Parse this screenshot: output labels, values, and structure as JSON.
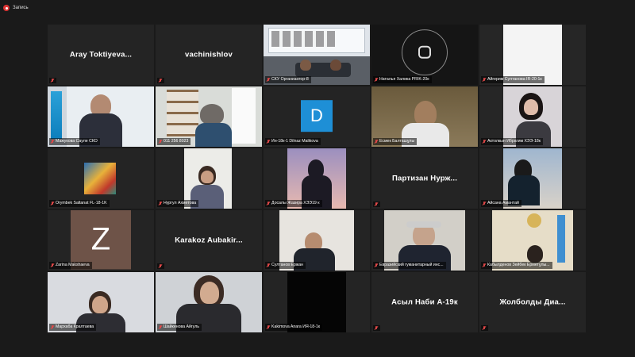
{
  "recording": {
    "label": "Запись"
  },
  "tiles": [
    {
      "kind": "name",
      "center": "Aray  Toktiyeva...",
      "plate": ""
    },
    {
      "kind": "name",
      "center": "vachinishlov",
      "plate": ""
    },
    {
      "kind": "video",
      "plate": "СКУ Организатор-8",
      "active": true
    },
    {
      "kind": "video",
      "plate": "Наталья Халика PRIK-20к"
    },
    {
      "kind": "video",
      "plate": "Айгерим Султанова IR-20-1к"
    },
    {
      "kind": "video",
      "plate": "Мажукова Сауле   СКО"
    },
    {
      "kind": "video",
      "plate": "011 256 8023"
    },
    {
      "kind": "avatar",
      "letter": "D",
      "plate": "Ин-18к-1 Dilnaz Malikova"
    },
    {
      "kind": "video",
      "plate": "Есмек Балташұлы"
    },
    {
      "kind": "video",
      "plate": "Актолкын Ибрагим ХЭЭ-18к"
    },
    {
      "kind": "video",
      "plate": "Orymbek Saltanat FL-18-1K"
    },
    {
      "kind": "video",
      "plate": "Нургул Ахметова"
    },
    {
      "kind": "video",
      "plate": "Досалы Жазира ХЭЭ19 к"
    },
    {
      "kind": "name",
      "center": "Партизан  Нурж...",
      "plate": ""
    },
    {
      "kind": "video",
      "plate": "Айсана Амантай"
    },
    {
      "kind": "avatar",
      "letter": "Z",
      "plate": "Zarina Makshaeva"
    },
    {
      "kind": "name",
      "center": "Karakoz  Aubakir...",
      "plate": ""
    },
    {
      "kind": "video",
      "plate": "Султанов Ержан"
    },
    {
      "kind": "video",
      "plate": "Евразийский гуманитарный инс..."
    },
    {
      "kind": "video",
      "plate": "Кабылденов Зейбек Ерметұлы..."
    },
    {
      "kind": "video",
      "plate": "Мархаба Кралтаева"
    },
    {
      "kind": "video",
      "plate": "Шайкенова Айгуль"
    },
    {
      "kind": "video",
      "plate": "Kakimova Anara ИЯ-18-1к"
    },
    {
      "kind": "name",
      "center": "Асыл Наби А-19к",
      "plate": ""
    },
    {
      "kind": "name",
      "center": "Жолболды  Диа...",
      "plate": ""
    }
  ],
  "colors": {
    "background": "#1a1a1a",
    "tile": "#242424",
    "active_border": "#c9e34a",
    "muted_icon": "#e04848"
  }
}
